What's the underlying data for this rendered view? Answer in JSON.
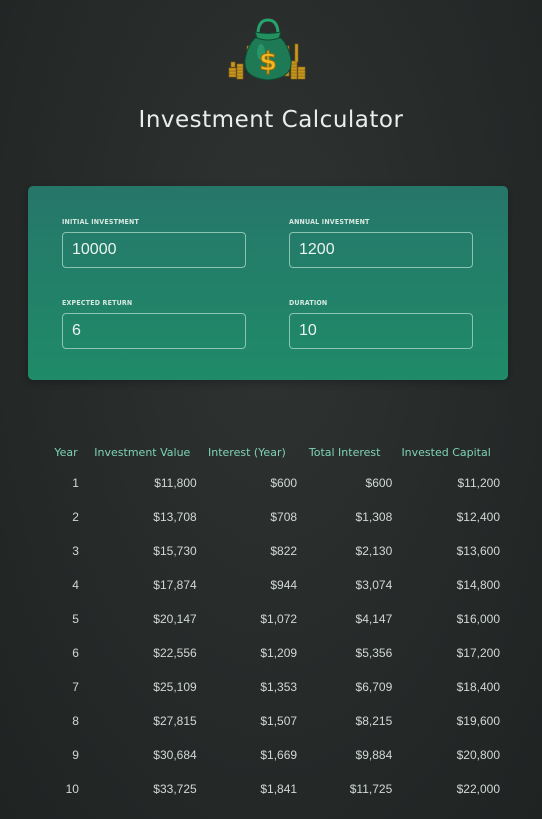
{
  "header": {
    "title": "Investment Calculator",
    "logo_icon": "money-bag-icon"
  },
  "colors": {
    "panel_top": "#26766a",
    "panel_bottom": "#1f8b68",
    "header_text": "#7ed3b5",
    "background": "#262a29"
  },
  "inputs": {
    "initial_investment": {
      "label": "INITIAL INVESTMENT",
      "value": "10000"
    },
    "annual_investment": {
      "label": "ANNUAL INVESTMENT",
      "value": "1200"
    },
    "expected_return": {
      "label": "EXPECTED RETURN",
      "value": "6"
    },
    "duration": {
      "label": "DURATION",
      "value": "10"
    }
  },
  "table": {
    "headers": [
      "Year",
      "Investment Value",
      "Interest (Year)",
      "Total Interest",
      "Invested Capital"
    ],
    "rows": [
      [
        "1",
        "$11,800",
        "$600",
        "$600",
        "$11,200"
      ],
      [
        "2",
        "$13,708",
        "$708",
        "$1,308",
        "$12,400"
      ],
      [
        "3",
        "$15,730",
        "$822",
        "$2,130",
        "$13,600"
      ],
      [
        "4",
        "$17,874",
        "$944",
        "$3,074",
        "$14,800"
      ],
      [
        "5",
        "$20,147",
        "$1,072",
        "$4,147",
        "$16,000"
      ],
      [
        "6",
        "$22,556",
        "$1,209",
        "$5,356",
        "$17,200"
      ],
      [
        "7",
        "$25,109",
        "$1,353",
        "$6,709",
        "$18,400"
      ],
      [
        "8",
        "$27,815",
        "$1,507",
        "$8,215",
        "$19,600"
      ],
      [
        "9",
        "$30,684",
        "$1,669",
        "$9,884",
        "$20,800"
      ],
      [
        "10",
        "$33,725",
        "$1,841",
        "$11,725",
        "$22,000"
      ]
    ]
  }
}
